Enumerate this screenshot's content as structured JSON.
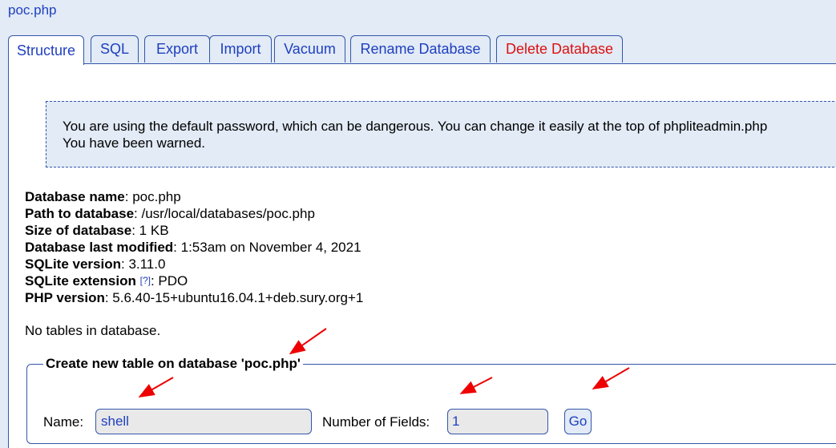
{
  "header": {
    "db_title": "poc.php"
  },
  "tabs": [
    {
      "label": "Structure"
    },
    {
      "label": "SQL"
    },
    {
      "label": "Export"
    },
    {
      "label": "Import"
    },
    {
      "label": "Vacuum"
    },
    {
      "label": "Rename Database"
    },
    {
      "label": "Delete Database"
    }
  ],
  "warning": {
    "line1": "You are using the default password, which can be dangerous. You can change it easily at the top of phpliteadmin.php",
    "line2": "You have been warned."
  },
  "info": {
    "db_name_label": "Database name",
    "db_name": "poc.php",
    "path_label": "Path to database",
    "path": "/usr/local/databases/poc.php",
    "size_label": "Size of database",
    "size": "1 KB",
    "modified_label": "Database last modified",
    "modified": "1:53am on November 4, 2021",
    "sqlite_version_label": "SQLite version",
    "sqlite_version": "3.11.0",
    "sqlite_ext_label": "SQLite extension",
    "sqlite_ext_help": "[?]",
    "sqlite_ext": "PDO",
    "php_version_label": "PHP version",
    "php_version": "5.6.40-15+ubuntu16.04.1+deb.sury.org+1"
  },
  "no_tables": "No tables in database.",
  "create_table": {
    "legend": "Create new table on database 'poc.php'",
    "name_label": "Name:",
    "name_value": "shell",
    "fields_label": "Number of Fields:",
    "fields_value": "1",
    "go_label": "Go"
  },
  "colors": {
    "link": "#1f3fbf",
    "danger": "#dd1111",
    "arrow": "#ee0000",
    "border": "#3355aa"
  }
}
